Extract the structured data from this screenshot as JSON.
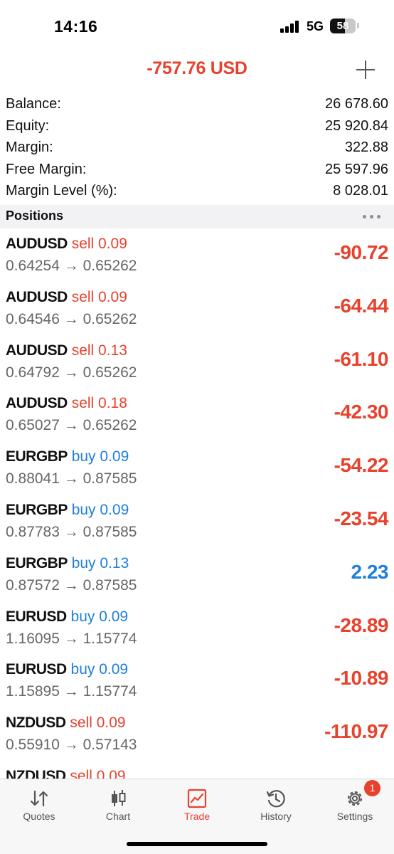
{
  "status_bar": {
    "time": "14:16",
    "network": "5G",
    "battery": "58",
    "battery_level": 0.58
  },
  "header": {
    "total_profit": "-757.76 USD",
    "add_icon": "plus-icon"
  },
  "summary": [
    {
      "label": "Balance:",
      "value": "26 678.60"
    },
    {
      "label": "Equity:",
      "value": "25 920.84"
    },
    {
      "label": "Margin:",
      "value": "322.88"
    },
    {
      "label": "Free Margin:",
      "value": "25 597.96"
    },
    {
      "label": "Margin Level (%):",
      "value": "8 028.01"
    }
  ],
  "positions_section": {
    "title": "Positions",
    "menu_icon": "more-horizontal-icon"
  },
  "positions": [
    {
      "symbol": "AUDUSD",
      "side": "sell",
      "volume": "0.09",
      "prices": "0.64254 → 0.65262",
      "profit": "-90.72"
    },
    {
      "symbol": "AUDUSD",
      "side": "sell",
      "volume": "0.09",
      "prices": "0.64546 → 0.65262",
      "profit": "-64.44"
    },
    {
      "symbol": "AUDUSD",
      "side": "sell",
      "volume": "0.13",
      "prices": "0.64792 → 0.65262",
      "profit": "-61.10"
    },
    {
      "symbol": "AUDUSD",
      "side": "sell",
      "volume": "0.18",
      "prices": "0.65027 → 0.65262",
      "profit": "-42.30"
    },
    {
      "symbol": "EURGBP",
      "side": "buy",
      "volume": "0.09",
      "prices": "0.88041 → 0.87585",
      "profit": "-54.22"
    },
    {
      "symbol": "EURGBP",
      "side": "buy",
      "volume": "0.09",
      "prices": "0.87783 → 0.87585",
      "profit": "-23.54"
    },
    {
      "symbol": "EURGBP",
      "side": "buy",
      "volume": "0.13",
      "prices": "0.87572 → 0.87585",
      "profit": "2.23"
    },
    {
      "symbol": "EURUSD",
      "side": "buy",
      "volume": "0.09",
      "prices": "1.16095 → 1.15774",
      "profit": "-28.89"
    },
    {
      "symbol": "EURUSD",
      "side": "buy",
      "volume": "0.09",
      "prices": "1.15895 → 1.15774",
      "profit": "-10.89"
    },
    {
      "symbol": "NZDUSD",
      "side": "sell",
      "volume": "0.09",
      "prices": "0.55910 → 0.57143",
      "profit": "-110.97"
    },
    {
      "symbol": "NZDUSD",
      "side": "sell",
      "volume": "0.09",
      "prices": "",
      "profit": ""
    }
  ],
  "colors": {
    "loss": "#e8412c",
    "gain": "#1e7fdc",
    "active_tab": "#e8412c"
  },
  "tab_bar": {
    "tabs": [
      {
        "label": "Quotes",
        "icon": "quotes-arrows-icon",
        "active": false
      },
      {
        "label": "Chart",
        "icon": "candlestick-icon",
        "active": false
      },
      {
        "label": "Trade",
        "icon": "trade-chart-icon",
        "active": true
      },
      {
        "label": "History",
        "icon": "history-clock-icon",
        "active": false
      },
      {
        "label": "Settings",
        "icon": "gear-icon",
        "active": false,
        "badge": "1"
      }
    ]
  }
}
